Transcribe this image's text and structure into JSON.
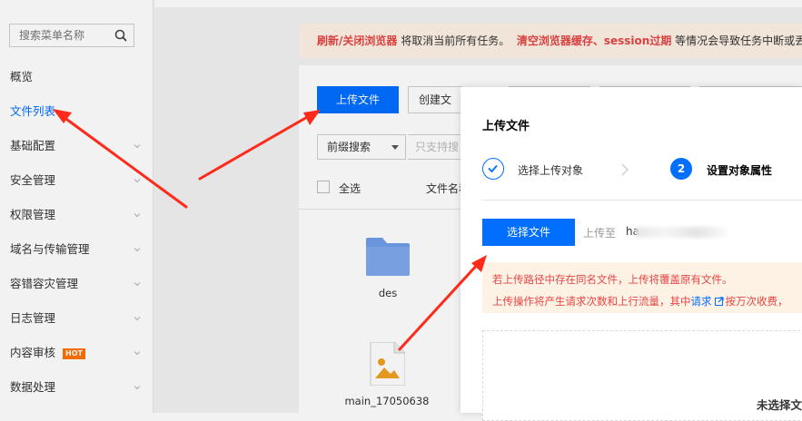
{
  "sidebar": {
    "search_placeholder": "搜索菜单名称",
    "items": [
      {
        "label": "概览",
        "active": false,
        "has_chevron": false
      },
      {
        "label": "文件列表",
        "active": true,
        "has_chevron": false
      },
      {
        "label": "基础配置",
        "active": false,
        "has_chevron": true
      },
      {
        "label": "安全管理",
        "active": false,
        "has_chevron": true
      },
      {
        "label": "权限管理",
        "active": false,
        "has_chevron": true
      },
      {
        "label": "域名与传输管理",
        "active": false,
        "has_chevron": true
      },
      {
        "label": "容错容灾管理",
        "active": false,
        "has_chevron": true
      },
      {
        "label": "日志管理",
        "active": false,
        "has_chevron": true
      },
      {
        "label": "内容审核",
        "active": false,
        "has_chevron": true,
        "badge": "HOT"
      },
      {
        "label": "数据处理",
        "active": false,
        "has_chevron": true
      }
    ]
  },
  "alert": {
    "part1_bold": "刷新/关闭浏览器",
    "part2": " 将取消当前所有任务。",
    "part3_bold": "清空浏览器缓存、session过期",
    "part4": " 等情况会导致任务中断或丢失"
  },
  "toolbar": {
    "upload_label": "上传文件",
    "create_label": "创建文",
    "prefix_select": "前缀搜索",
    "filter_placeholder": "只支持搜"
  },
  "list": {
    "select_all": "全选",
    "name_header": "文件名称",
    "items": [
      {
        "name": "des",
        "icon": "folder-icon"
      },
      {
        "name": "main_17050638",
        "icon": "image-file-icon"
      }
    ]
  },
  "dialog": {
    "title": "上传文件",
    "steps": [
      {
        "label": "选择上传对象",
        "state": "done"
      },
      {
        "number": "2",
        "label": "设置对象属性",
        "state": "current"
      }
    ],
    "choose_file_label": "选择文件",
    "upload_to_label": "上传至",
    "upload_to_value": "ha",
    "warning_line1": "若上传路径中存在同名文件，上传将覆盖原有文件。",
    "warning_line2_prefix": "上传操作将产生请求次数和上行流量，其中",
    "warning_link": "请求",
    "warning_line2_suffix": "按万次收费，",
    "empty_text": "未选择文"
  },
  "colors": {
    "primary": "#006eff",
    "danger": "#e54545",
    "warning_bg": "#fef2e5",
    "annotation_arrow": "#ff2a1a"
  }
}
